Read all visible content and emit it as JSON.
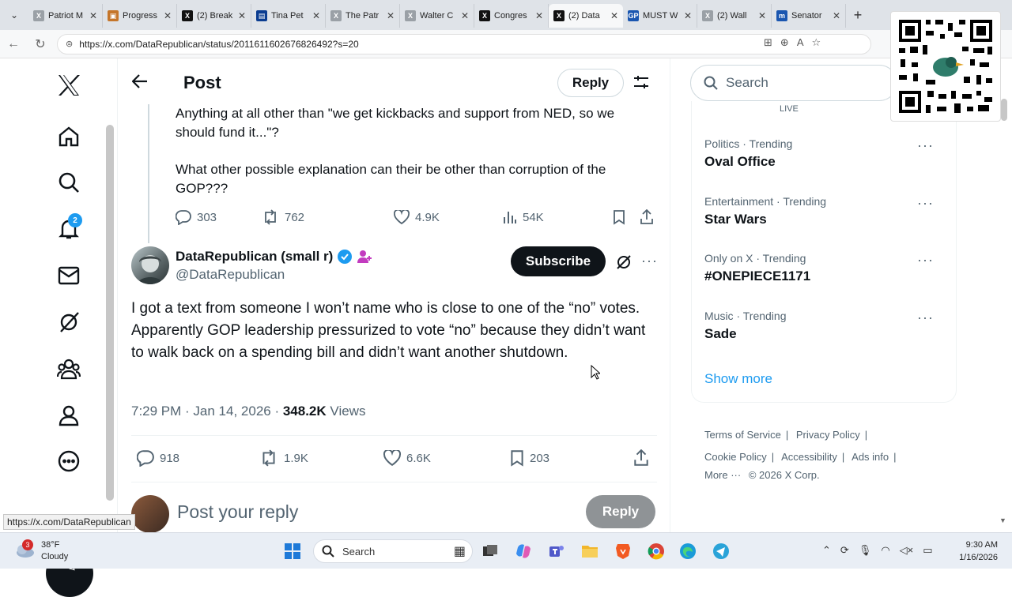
{
  "browser": {
    "tabs": [
      {
        "label": "Patriot M",
        "icon": "x-logo-icon"
      },
      {
        "label": "Progress",
        "icon": "progress-icon"
      },
      {
        "label": "(2) Break",
        "icon": "x-logo-icon"
      },
      {
        "label": "Tina Pet",
        "icon": "news-icon"
      },
      {
        "label": "The Patr",
        "icon": "x-logo-icon"
      },
      {
        "label": "Walter C",
        "icon": "x-logo-icon"
      },
      {
        "label": "Congres",
        "icon": "x-logo-icon"
      },
      {
        "label": "(2) Data",
        "icon": "x-logo-icon"
      },
      {
        "label": "MUST W",
        "icon": "gp-icon"
      },
      {
        "label": "(2) Wall",
        "icon": "x-logo-icon"
      },
      {
        "label": "Senator",
        "icon": "m-icon"
      }
    ],
    "url": "https://x.com/DataRepublican/status/2011611602676826492?s=20",
    "status_url": "https://x.com/DataRepublican"
  },
  "sidebar": {
    "notification_count": "2"
  },
  "header": {
    "title": "Post",
    "reply_label": "Reply"
  },
  "previous_post": {
    "lines": [
      "Anything at all other than \"we get kickbacks and support from NED, so we should fund it...\"?",
      "What other possible explanation can their be other than corruption of the GOP???"
    ],
    "replies": "303",
    "reposts": "762",
    "likes": "4.9K",
    "views": "54K"
  },
  "post": {
    "author_name": "DataRepublican (small r)",
    "handle": "@DataRepublican",
    "subscribe_label": "Subscribe",
    "text": "I got a text from someone I won’t name who is close to one of the “no” votes. Apparently GOP leadership pressurized to vote “no” because they didn’t want to walk back on a spending bill and didn’t want another shutdown.",
    "time": "7:29 PM",
    "date": "Jan 14, 2026",
    "views_count": "348.2K",
    "views_label": "Views",
    "replies": "918",
    "reposts": "1.9K",
    "likes": "6.6K",
    "bookmarks": "203"
  },
  "reply_box": {
    "placeholder": "Post your reply",
    "button": "Reply"
  },
  "right": {
    "search_placeholder": "Search",
    "live_label": "LIVE",
    "trends": [
      {
        "category": "Politics · Trending",
        "name": "Oval Office"
      },
      {
        "category": "Entertainment · Trending",
        "name": "Star Wars"
      },
      {
        "category": "Only on X · Trending",
        "name": "#ONEPIECE1171"
      },
      {
        "category": "Music · Trending",
        "name": "Sade"
      }
    ],
    "show_more": "Show more",
    "footer": {
      "terms": "Terms of Service",
      "privacy": "Privacy Policy",
      "cookie": "Cookie Policy",
      "accessibility": "Accessibility",
      "ads": "Ads info",
      "more": "More ···",
      "copyright": "© 2026 X Corp."
    }
  },
  "taskbar": {
    "temperature": "38°F",
    "condition": "Cloudy",
    "weather_badge": "3",
    "search_label": "Search",
    "time": "9:30 AM",
    "date": "1/16/2026"
  },
  "colors": {
    "accent": "#1d9bf0",
    "text": "#0f1419",
    "muted": "#536471"
  }
}
